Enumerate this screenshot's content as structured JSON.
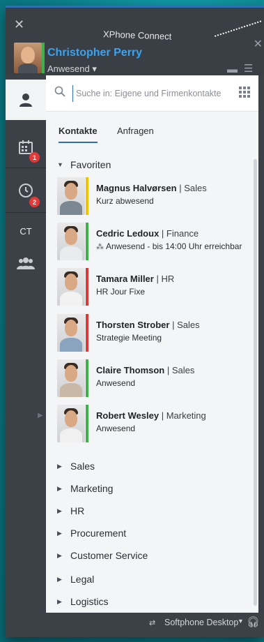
{
  "app": {
    "title": "XPhone Connect"
  },
  "user": {
    "name": "Christopher Perry",
    "status": "Anwesend ▾"
  },
  "search": {
    "placeholder": "Suche in: Eigene und Firmenkontakte"
  },
  "tabs": [
    {
      "label": "Kontakte"
    },
    {
      "label": "Anfragen"
    }
  ],
  "nav": {
    "badges": {
      "calendar": "1",
      "history": "2"
    },
    "ct_label": "CT"
  },
  "favorites_group": {
    "label": "Favoriten"
  },
  "contacts": [
    {
      "name": "Magnus Halvørsen",
      "dept": "| Sales",
      "status": "Kurz abwesend",
      "status_color": "#f2c300",
      "shirt_color": "#7c8794"
    },
    {
      "name": "Cedric Ledoux",
      "dept": "| Finance",
      "status": "Anwesend - bis 14:00 Uhr erreichbar",
      "status_color": "#3fb14a",
      "shirt_color": "#e9ebee",
      "has_network_icon": true
    },
    {
      "name": "Tamara Miller",
      "dept": "| HR",
      "status": "HR Jour Fixe",
      "status_color": "#d93a3a",
      "shirt_color": "#f2f2f2"
    },
    {
      "name": "Thorsten Strober",
      "dept": "| Sales",
      "status": "Strategie Meeting",
      "status_color": "#d93a3a",
      "shirt_color": "#8aa3bf"
    },
    {
      "name": "Claire Thomson",
      "dept": "| Sales",
      "status": "Anwesend",
      "status_color": "#3fb14a",
      "shirt_color": "#c9b8a6"
    },
    {
      "name": "Robert Wesley",
      "dept": "| Marketing",
      "status": "Anwesend",
      "status_color": "#3fb14a",
      "shirt_color": "#f0f0f0"
    }
  ],
  "groups": [
    {
      "label": "Sales"
    },
    {
      "label": "Marketing"
    },
    {
      "label": "HR"
    },
    {
      "label": "Procurement"
    },
    {
      "label": "Customer Service"
    },
    {
      "label": "Legal"
    },
    {
      "label": "Logistics"
    }
  ],
  "footer": {
    "softphone_label": "Softphone Desktop"
  },
  "colors": {
    "accent": "#2f6fb0",
    "name_blue": "#3ba4f0",
    "badge_red": "#e23a3a"
  }
}
